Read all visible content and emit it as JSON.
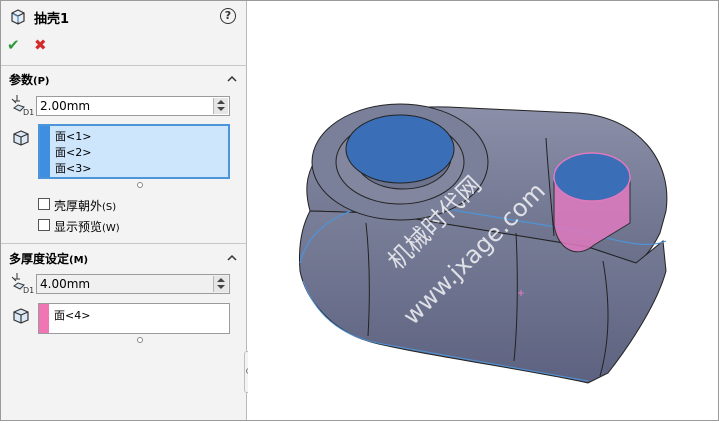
{
  "feature": {
    "title": "抽壳1",
    "help_icon": "help-icon",
    "help_text": "?"
  },
  "actions": {
    "ok_glyph": "✔",
    "cancel_glyph": "✖"
  },
  "parameters": {
    "title": "参数",
    "shortcut": "(P)",
    "thickness": "2.00mm",
    "faces": [
      "面<1>",
      "面<2>",
      "面<3>"
    ],
    "faces_color": "#3f8ee0",
    "shell_outward": {
      "label": "壳厚朝外",
      "shortcut": "(S)",
      "checked": false
    },
    "show_preview": {
      "label": "显示预览",
      "shortcut": "(W)",
      "checked": false
    }
  },
  "multi_thickness": {
    "title": "多厚度设定",
    "shortcut": "(M)",
    "thickness": "4.00mm",
    "faces": [
      "面<4>"
    ],
    "faces_color": "#f075b4"
  },
  "viewport": {
    "watermark_line1": "机械时代网",
    "watermark_line2": "www.jxage.com",
    "model_color": "#70758f",
    "selected_face_color": "#3a6fb8",
    "multi_face_color": "#e07ac0"
  }
}
